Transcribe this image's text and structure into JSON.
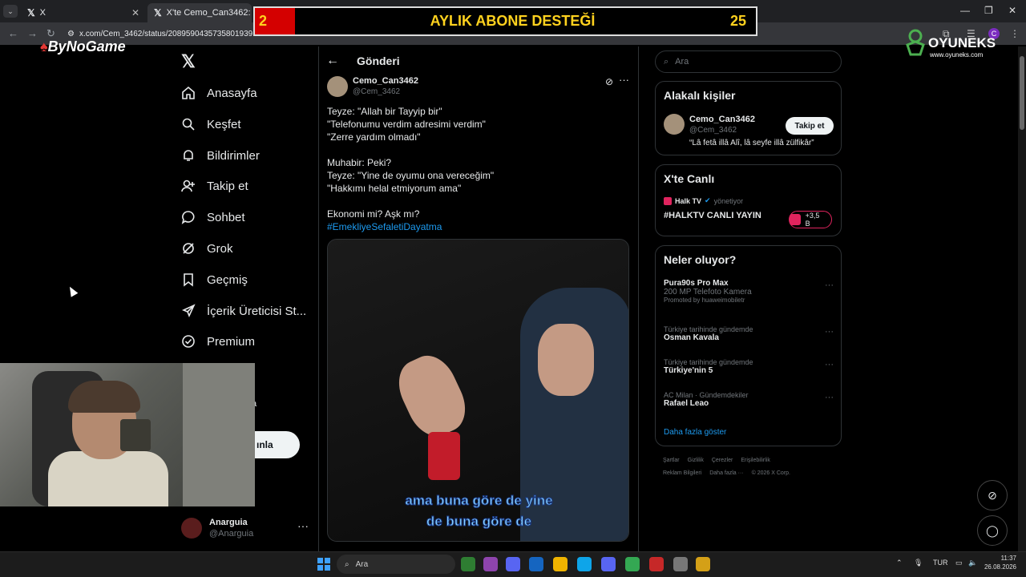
{
  "browser": {
    "tabs": [
      {
        "favicon": "x-logo",
        "title": "X"
      },
      {
        "favicon": "x-logo",
        "title": "X'te Cemo_Can3462: \"Teyze"
      }
    ],
    "address": "x.com/Cem_3462/status/2089590435735801939",
    "profile_initial": "C"
  },
  "overlays": {
    "banner": {
      "left_number": "2",
      "title": "AYLIK ABONE DESTEĞİ",
      "right_number": "25"
    },
    "bynogame": "ByNoGame",
    "oyuneks_name": "OYUNEKS",
    "oyuneks_url": "www.oyuneks.com"
  },
  "nav": {
    "items": [
      {
        "label": "Anasayfa",
        "icon": "home-icon"
      },
      {
        "label": "Keşfet",
        "icon": "search-icon"
      },
      {
        "label": "Bildirimler",
        "icon": "bell-icon"
      },
      {
        "label": "Takip et",
        "icon": "person-add-icon"
      },
      {
        "label": "Sohbet",
        "icon": "chat-icon"
      },
      {
        "label": "Grok",
        "icon": "grok-icon"
      },
      {
        "label": "Geçmiş",
        "icon": "bookmark-icon"
      },
      {
        "label": "İçerik Üreticisi St...",
        "icon": "rocket-icon"
      },
      {
        "label": "Premium",
        "icon": "premium-check-icon"
      }
    ],
    "hidden_item_fragment": "a",
    "post_button_fragment": "ınla",
    "profile": {
      "name": "Anarguia",
      "handle": "@Anarguia"
    }
  },
  "post": {
    "header": "Gönderi",
    "author": {
      "name": "Cemo_Can3462",
      "handle": "@Cem_3462"
    },
    "lines": [
      "Teyze: \"Allah bir Tayyip bir\"",
      "\"Telefonumu verdim adresimi verdim\"",
      "\"Zerre yardım olmadı\"",
      "",
      "Muhabir: Peki?",
      "Teyze: \"Yine de oyumu ona vereceğim\"",
      "\"Hakkımı helal etmiyorum ama\"",
      "",
      "Ekonomi mi? Aşk mı?"
    ],
    "hashtag": "#EmekliyeSefaletiDayatma",
    "video_captions": [
      "ama buna göre de yine",
      "de buna göre de"
    ]
  },
  "sidebar": {
    "search_placeholder": "Ara",
    "relevant": {
      "title": "Alakalı kişiler",
      "name": "Cemo_Can3462",
      "handle": "@Cem_3462",
      "bio": "“Lâ fetâ illâ Alî, lâ seyfe illâ zülfikâr”",
      "follow_label": "Takip et"
    },
    "live": {
      "title": "X'te Canlı",
      "source": "Halk TV",
      "source_note": "yönetiyor",
      "stream_title": "#HALKTV CANLI YAYIN",
      "viewers": "+3,5 B"
    },
    "trends": {
      "title": "Neler oluyor?",
      "items": [
        {
          "context": "",
          "name": "Pura90s Pro Max",
          "sub": "200 MP Telefoto Kamera",
          "promo": "Promoted by huaweimobiletr"
        },
        {
          "context": "Türkiye tarihinde gündemde",
          "name": "Osman Kavala",
          "sub": "",
          "promo": ""
        },
        {
          "context": "Türkiye tarihinde gündemde",
          "name": "Türkiye'nin 5",
          "sub": "",
          "promo": ""
        },
        {
          "context": "AC Milan · Gündemdekiler",
          "name": "Rafael Leao",
          "sub": "",
          "promo": ""
        }
      ],
      "show_more": "Daha fazla göster"
    },
    "footer_row1": [
      "Şartlar",
      "Gizlilik",
      "Çerezler",
      "Erişilebilirlik"
    ],
    "footer_row2": [
      "Reklam Bilgileri",
      "Daha fazla ···",
      "© 2026 X Corp."
    ]
  },
  "taskbar": {
    "search": "Ara",
    "language": "TUR",
    "time": "11:37",
    "date": "26.08.2026"
  }
}
